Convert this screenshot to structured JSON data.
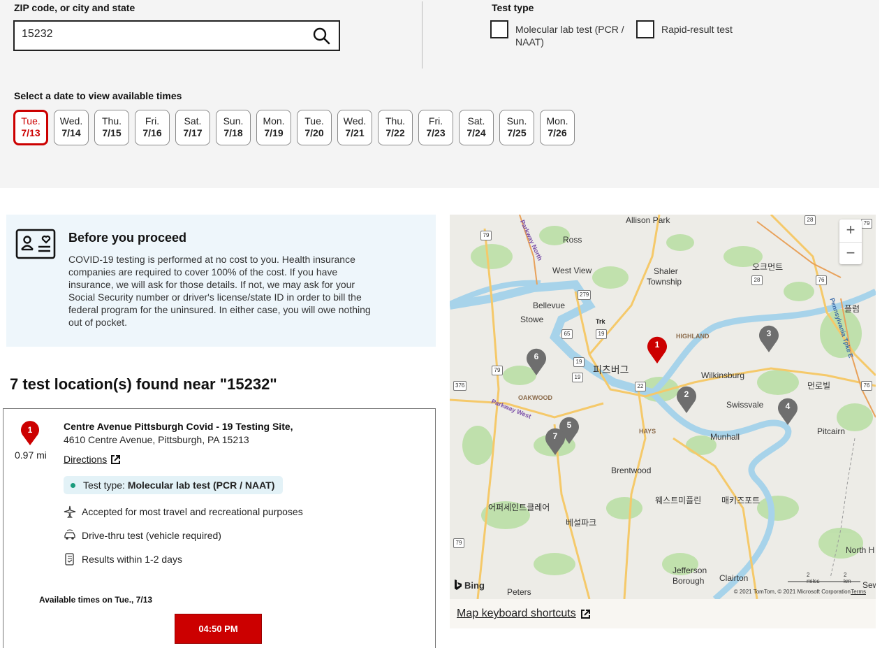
{
  "search": {
    "zip_label": "ZIP code, or city and state",
    "zip_value": "15232"
  },
  "test_type": {
    "label": "Test type",
    "options": [
      {
        "line1": "Molecular lab test (PCR /",
        "line2": "NAAT)",
        "checked": false
      },
      {
        "line1": "Rapid-result test",
        "line2": "",
        "checked": false
      }
    ]
  },
  "dates": {
    "label": "Select a date to view available times",
    "items": [
      {
        "dow": "Tue.",
        "md": "7/13",
        "selected": true
      },
      {
        "dow": "Wed.",
        "md": "7/14"
      },
      {
        "dow": "Thu.",
        "md": "7/15"
      },
      {
        "dow": "Fri.",
        "md": "7/16"
      },
      {
        "dow": "Sat.",
        "md": "7/17"
      },
      {
        "dow": "Sun.",
        "md": "7/18"
      },
      {
        "dow": "Mon.",
        "md": "7/19"
      },
      {
        "dow": "Tue.",
        "md": "7/20"
      },
      {
        "dow": "Wed.",
        "md": "7/21"
      },
      {
        "dow": "Thu.",
        "md": "7/22"
      },
      {
        "dow": "Fri.",
        "md": "7/23"
      },
      {
        "dow": "Sat.",
        "md": "7/24"
      },
      {
        "dow": "Sun.",
        "md": "7/25"
      },
      {
        "dow": "Mon.",
        "md": "7/26"
      }
    ],
    "selected_color": "#cc0000"
  },
  "proceed": {
    "title": "Before you proceed",
    "body": "COVID-19 testing is performed at no cost to you. Health insurance companies are required to cover 100% of the cost. If you have insurance, we will ask for those details. If not, we may ask for your Social Security number or driver's license/state ID in order to bill the federal program for the uninsured. In either case, you will owe nothing out of pocket."
  },
  "results": {
    "heading": "7 test location(s) found near \"15232\""
  },
  "location": {
    "pin_number": "1",
    "distance": "0.97 mi",
    "name": "Centre Avenue Pittsburgh Covid - 19 Testing Site,",
    "address": "4610 Centre Avenue, Pittsburgh, PA 15213",
    "directions_label": "Directions",
    "test_type_prefix": "Test type:",
    "test_type_value": "Molecular lab test (PCR / NAAT)",
    "features": [
      {
        "icon": "airplane-icon",
        "text": "Accepted for most travel and recreational purposes"
      },
      {
        "icon": "car-icon",
        "text": "Drive-thru test (vehicle required)"
      },
      {
        "icon": "phone-results-icon",
        "text": "Results within 1-2 days"
      }
    ],
    "available_label": "Available times on Tue., 7/13",
    "time_slots": [
      "04:50 PM"
    ]
  },
  "map": {
    "place_labels": [
      "Allison Park",
      "Ross",
      "West View",
      "Shaler",
      "Township",
      "오크먼트",
      "Bellevue",
      "Stowe",
      "피츠버그",
      "Wilkinsburg",
      "먼로빌",
      "Swissvale",
      "Pitcairn",
      "Munhall",
      "Brentwood",
      "어퍼세인트클레어",
      "웨스트미플린",
      "매키즈포트",
      "베설파크",
      "North H",
      "Jefferson",
      "Borough",
      "Clairton",
      "Peters",
      "Sew",
      "플럼",
      "HIGHLAND",
      "OAKWOOD",
      "HAYS",
      "Trk"
    ],
    "road_labels": [
      "Parkway North",
      "Parkway West",
      "Pennsylvania Tpke E"
    ],
    "shields": [
      "279",
      "79",
      "19",
      "65",
      "19",
      "19",
      "22",
      "79",
      "376",
      "79",
      "28",
      "28",
      "76",
      "76",
      "79"
    ],
    "pins": [
      {
        "n": "1",
        "color": "#cc0000"
      },
      {
        "n": "2",
        "color": "#6e6e6e"
      },
      {
        "n": "3",
        "color": "#6e6e6e"
      },
      {
        "n": "4",
        "color": "#6e6e6e"
      },
      {
        "n": "5",
        "color": "#6e6e6e"
      },
      {
        "n": "6",
        "color": "#6e6e6e"
      },
      {
        "n": "7",
        "color": "#6e6e6e"
      }
    ],
    "zoom_in": "+",
    "zoom_out": "−",
    "bing": "Bing",
    "scale_miles": "2 miles",
    "scale_km": "2 km",
    "attribution": "© 2021 TomTom, © 2021 Microsoft Corporation",
    "terms": "Terms",
    "shortcuts_label": "Map keyboard shortcuts"
  }
}
